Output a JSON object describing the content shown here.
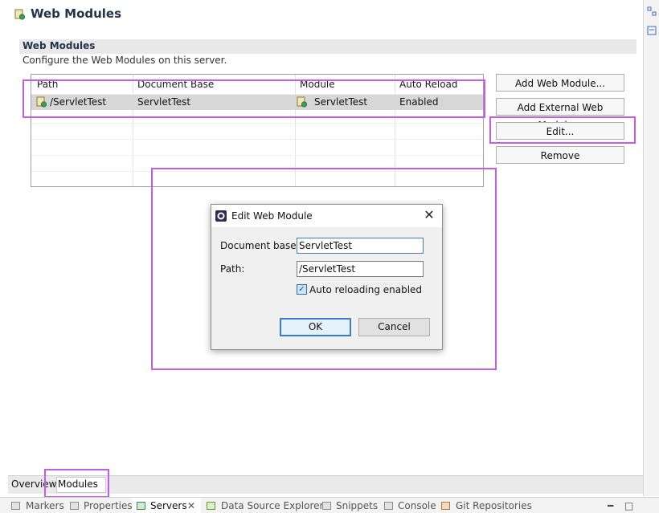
{
  "editor": {
    "title": "Web Modules",
    "section": {
      "title": "Web Modules",
      "description": "Configure the Web Modules on this server."
    },
    "table": {
      "columns": [
        "Path",
        "Document Base",
        "Module",
        "Auto Reload"
      ],
      "rows": [
        {
          "path": "/ServletTest",
          "document_base": "ServletTest",
          "module": "ServletTest",
          "auto_reload": "Enabled"
        }
      ]
    },
    "buttons": {
      "add_web_module": "Add Web Module...",
      "add_external": "Add External Web Module...",
      "edit": "Edit...",
      "remove": "Remove"
    },
    "tabs": [
      "Overview",
      "Modules"
    ]
  },
  "dialog": {
    "title": "Edit Web Module",
    "document_base_label": "Document base:",
    "document_base_value": "ServletTest",
    "path_label": "Path:",
    "path_value": "/ServletTest",
    "checkbox_label": "Auto reloading enabled",
    "checkbox_checked": true,
    "ok": "OK",
    "cancel": "Cancel"
  },
  "views": {
    "tabs": [
      "Markers",
      "Properties",
      "Servers",
      "Data Source Explorer",
      "Snippets",
      "Console",
      "Git Repositories"
    ],
    "active": "Servers"
  },
  "colors": {
    "highlight": "#c75be9",
    "title_text": "#23344d",
    "selection": "#d7d7d7"
  }
}
